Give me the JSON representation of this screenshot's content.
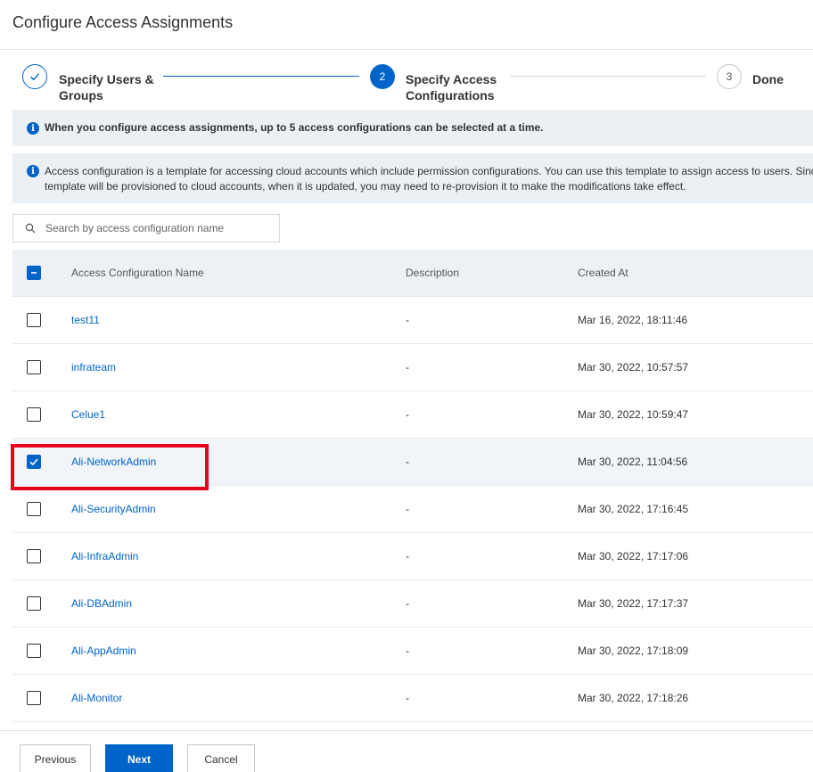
{
  "header": {
    "title": "Configure Access Assignments"
  },
  "steps": [
    {
      "number": "",
      "label": "Specify Users & Groups",
      "state": "completed"
    },
    {
      "number": "2",
      "label": "Specify Access Configurations",
      "state": "active"
    },
    {
      "number": "3",
      "label": "Done",
      "state": "pending"
    }
  ],
  "notices": {
    "limit": "When you configure access assignments, up to 5 access configurations can be selected at a time.",
    "template_line1": "Access configuration is a template for accessing cloud accounts which include permission configurations. You can use this template to assign access to users. Since",
    "template_line2": "template will be provisioned to cloud accounts, when it is updated, you may need to re-provision it to make the modifications take effect."
  },
  "search": {
    "placeholder": "Search by access configuration name",
    "value": ""
  },
  "table": {
    "columns": {
      "name": "Access Configuration Name",
      "description": "Description",
      "created_at": "Created At"
    },
    "rows": [
      {
        "name": "test11",
        "description": "-",
        "created_at": "Mar 16, 2022, 18:11:46",
        "checked": false
      },
      {
        "name": "infrateam",
        "description": "-",
        "created_at": "Mar 30, 2022, 10:57:57",
        "checked": false
      },
      {
        "name": "Celue1",
        "description": "-",
        "created_at": "Mar 30, 2022, 10:59:47",
        "checked": false
      },
      {
        "name": "Ali-NetworkAdmin",
        "description": "-",
        "created_at": "Mar 30, 2022, 11:04:56",
        "checked": true
      },
      {
        "name": "Ali-SecurityAdmin",
        "description": "-",
        "created_at": "Mar 30, 2022, 17:16:45",
        "checked": false
      },
      {
        "name": "Ali-InfraAdmin",
        "description": "-",
        "created_at": "Mar 30, 2022, 17:17:06",
        "checked": false
      },
      {
        "name": "Ali-DBAdmin",
        "description": "-",
        "created_at": "Mar 30, 2022, 17:17:37",
        "checked": false
      },
      {
        "name": "Ali-AppAdmin",
        "description": "-",
        "created_at": "Mar 30, 2022, 17:18:09",
        "checked": false
      },
      {
        "name": "Ali-Monitor",
        "description": "-",
        "created_at": "Mar 30, 2022, 17:18:26",
        "checked": false
      }
    ]
  },
  "footer": {
    "previous": "Previous",
    "next": "Next",
    "cancel": "Cancel"
  },
  "colors": {
    "primary": "#0064c8",
    "highlight": "#e8001c",
    "notice_bg": "#ebf0f5"
  }
}
